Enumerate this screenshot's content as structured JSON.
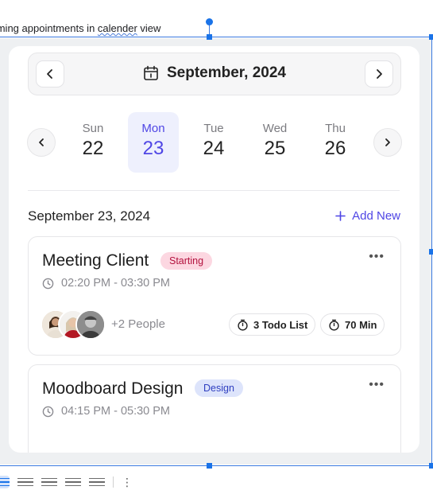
{
  "caption": {
    "before": "coming appointments in ",
    "underlined": "calender",
    "after": " view"
  },
  "month": {
    "title": "September, 2024"
  },
  "week": {
    "days": [
      {
        "name": "Sun",
        "date": "22",
        "selected": false
      },
      {
        "name": "Mon",
        "date": "23",
        "selected": true
      },
      {
        "name": "Tue",
        "date": "24",
        "selected": false
      },
      {
        "name": "Wed",
        "date": "25",
        "selected": false
      },
      {
        "name": "Thu",
        "date": "26",
        "selected": false
      }
    ]
  },
  "section": {
    "date_heading": "September 23, 2024",
    "add_new_label": "Add New"
  },
  "appointments": [
    {
      "title": "Meeting Client",
      "tag": "Starting",
      "tag_color": "#fcd7e1",
      "time": "02:20 PM - 03:30 PM",
      "people": "+2 People",
      "todo": "3 Todo List",
      "duration": "70 Min"
    },
    {
      "title": "Moodboard Design",
      "tag": "Design",
      "tag_color": "#dde4fb",
      "time": "04:15 PM - 05:30 PM"
    }
  ],
  "colors": {
    "accent": "#4f46e5",
    "selection": "#1a73e8"
  },
  "icons": {
    "prev": "chevron-left-icon",
    "next": "chevron-right-icon",
    "calendar": "calendar-icon",
    "clock": "clock-icon",
    "timer": "stopwatch-icon",
    "more": "more-horizontal-icon",
    "add": "plus-icon"
  }
}
